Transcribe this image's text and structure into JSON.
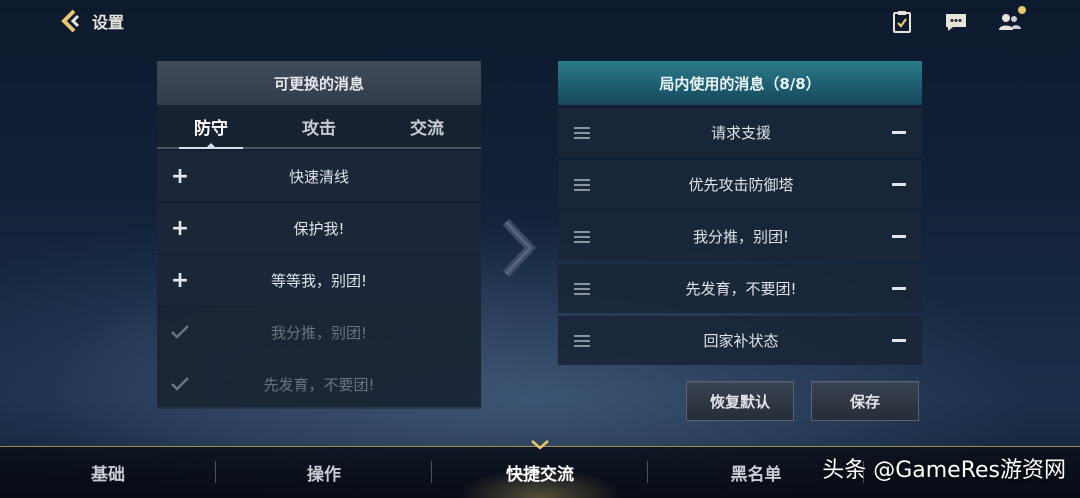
{
  "header": {
    "back_label": "设置",
    "icons": [
      "task-icon",
      "chat-icon",
      "friends-icon"
    ]
  },
  "left_panel": {
    "title": "可更换的消息",
    "tabs": [
      {
        "label": "防守",
        "active": true
      },
      {
        "label": "攻击",
        "active": false
      },
      {
        "label": "交流",
        "active": false
      }
    ],
    "items": [
      {
        "label": "快速清线",
        "used": false
      },
      {
        "label": "保护我!",
        "used": false
      },
      {
        "label": "等等我，别团!",
        "used": false
      },
      {
        "label": "我分推，别团!",
        "used": true
      },
      {
        "label": "先发育，不要团!",
        "used": true
      }
    ]
  },
  "right_panel": {
    "title": "局内使用的消息（8/8）",
    "items": [
      {
        "label": "请求支援"
      },
      {
        "label": "优先攻击防御塔"
      },
      {
        "label": "我分推，别团!"
      },
      {
        "label": "先发育，不要团!"
      },
      {
        "label": "回家补状态"
      }
    ]
  },
  "buttons": {
    "reset_label": "恢复默认",
    "save_label": "保存"
  },
  "bottom_nav": [
    {
      "label": "基础",
      "active": false
    },
    {
      "label": "操作",
      "active": false
    },
    {
      "label": "快捷交流",
      "active": true
    },
    {
      "label": "黑名单",
      "active": false
    },
    {
      "label": "",
      "active": false
    }
  ],
  "watermark": "头条 @GameRes游资网",
  "colors": {
    "accent_teal": "#1e5f70",
    "gold": "#e8c86a"
  }
}
